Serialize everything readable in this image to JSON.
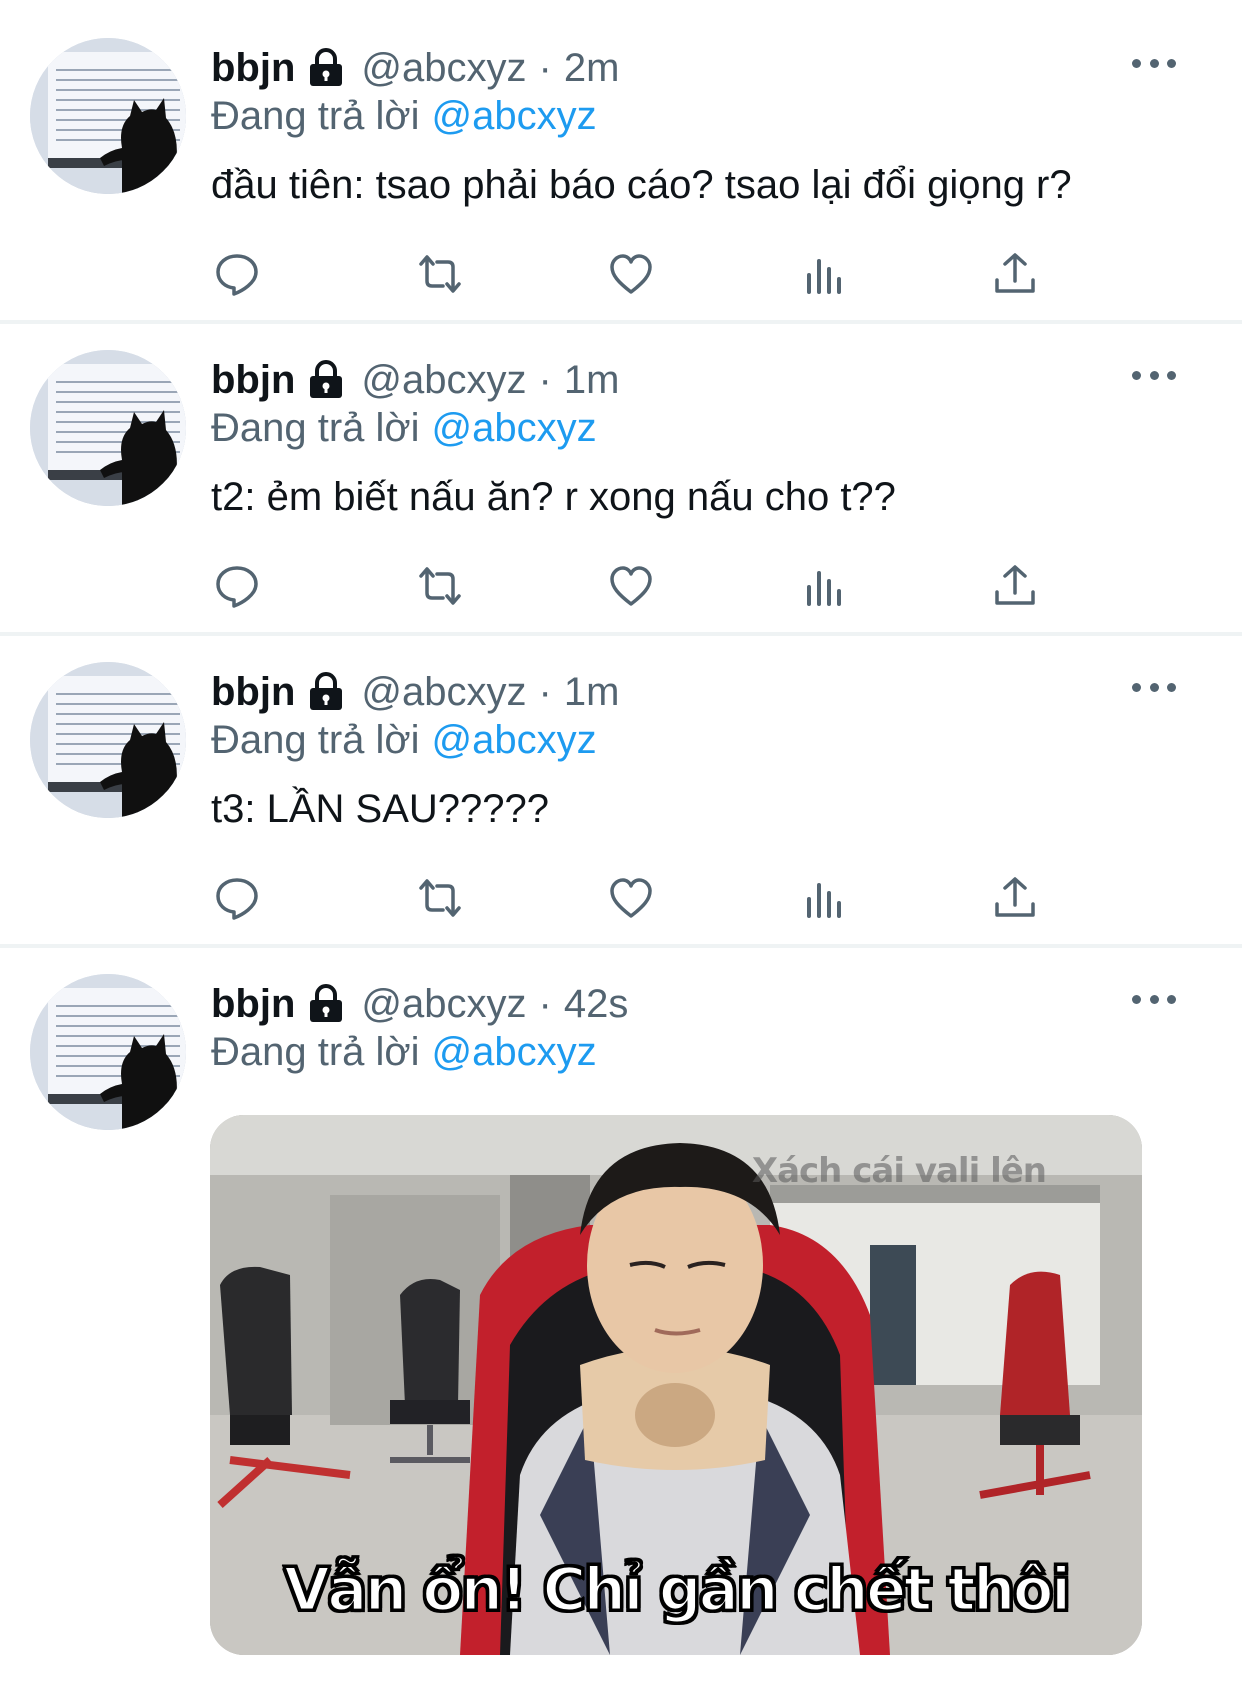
{
  "tweets": [
    {
      "name": "bbjn",
      "handle": "@abcxyz",
      "separator": "·",
      "time": "2m",
      "reply_prefix": "Đang trả lời",
      "reply_to": "@abcxyz",
      "text": "đầu tiên: tsao phải báo cáo? tsao lại đổi giọng r?"
    },
    {
      "name": "bbjn",
      "handle": "@abcxyz",
      "separator": "·",
      "time": "1m",
      "reply_prefix": "Đang trả lời",
      "reply_to": "@abcxyz",
      "text": "t2: ẻm biết nấu ăn? r xong nấu cho t??"
    },
    {
      "name": "bbjn",
      "handle": "@abcxyz",
      "separator": "·",
      "time": "1m",
      "reply_prefix": "Đang trả lời",
      "reply_to": "@abcxyz",
      "text": "t3: LẦN SAU?????"
    },
    {
      "name": "bbjn",
      "handle": "@abcxyz",
      "separator": "·",
      "time": "42s",
      "reply_prefix": "Đang trả lời",
      "reply_to": "@abcxyz",
      "media": {
        "watermark": "Xách cái vali lên",
        "caption": "Vẫn ổn! Chỉ gần chết thôi"
      }
    }
  ],
  "icons": {
    "lock": "lock-icon",
    "more": "more-icon",
    "reply": "reply-icon",
    "retweet": "retweet-icon",
    "like": "like-icon",
    "views": "views-icon",
    "share": "share-icon"
  },
  "colors": {
    "text_primary": "#0f1419",
    "text_secondary": "#536471",
    "link": "#1d9bf0",
    "divider": "#eff3f4"
  }
}
